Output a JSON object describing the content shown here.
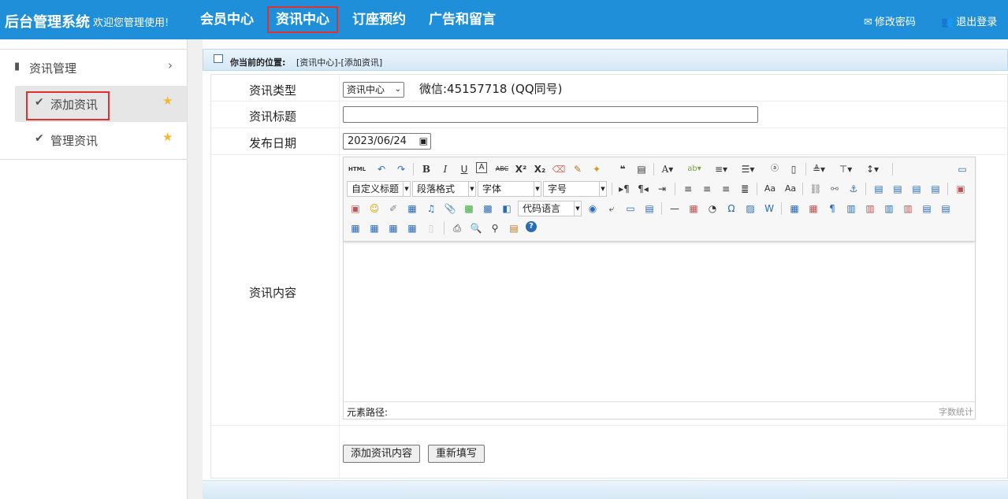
{
  "header": {
    "brand": "后台管理系统",
    "welcome": "欢迎您管理使用!",
    "nav": [
      {
        "label": "会员中心",
        "active": false
      },
      {
        "label": "资讯中心",
        "active": true
      },
      {
        "label": "订座预约",
        "active": false
      },
      {
        "label": "广告和留言",
        "active": false
      }
    ],
    "change_password": "修改密码",
    "logout": "退出登录"
  },
  "sidebar": {
    "group_label": "资讯管理",
    "items": [
      {
        "label": "添加资讯",
        "active": true
      },
      {
        "label": "管理资讯",
        "active": false
      }
    ]
  },
  "breadcrumb": {
    "title": "你当前的位置:",
    "path": "[资讯中心]-[添加资讯]"
  },
  "form": {
    "type_label": "资讯类型",
    "type_value": "资讯中心",
    "wechat_note": "微信:45157718 (QQ同号)",
    "title_label": "资讯标题",
    "title_value": "",
    "date_label": "发布日期",
    "date_value": "2023/06/24",
    "content_label": "资讯内容",
    "editor": {
      "selects": {
        "heading": "自定义标题",
        "paragraph": "段落格式",
        "font": "字体",
        "size": "字号",
        "code": "代码语言"
      },
      "element_path": "元素路径:",
      "word_count": "字数统计"
    },
    "submit_label": "添加资讯内容",
    "reset_label": "重新填写"
  },
  "colors": {
    "header_bg": "#1e8fd8",
    "highlight": "#e03030",
    "star": "#f5b731"
  }
}
